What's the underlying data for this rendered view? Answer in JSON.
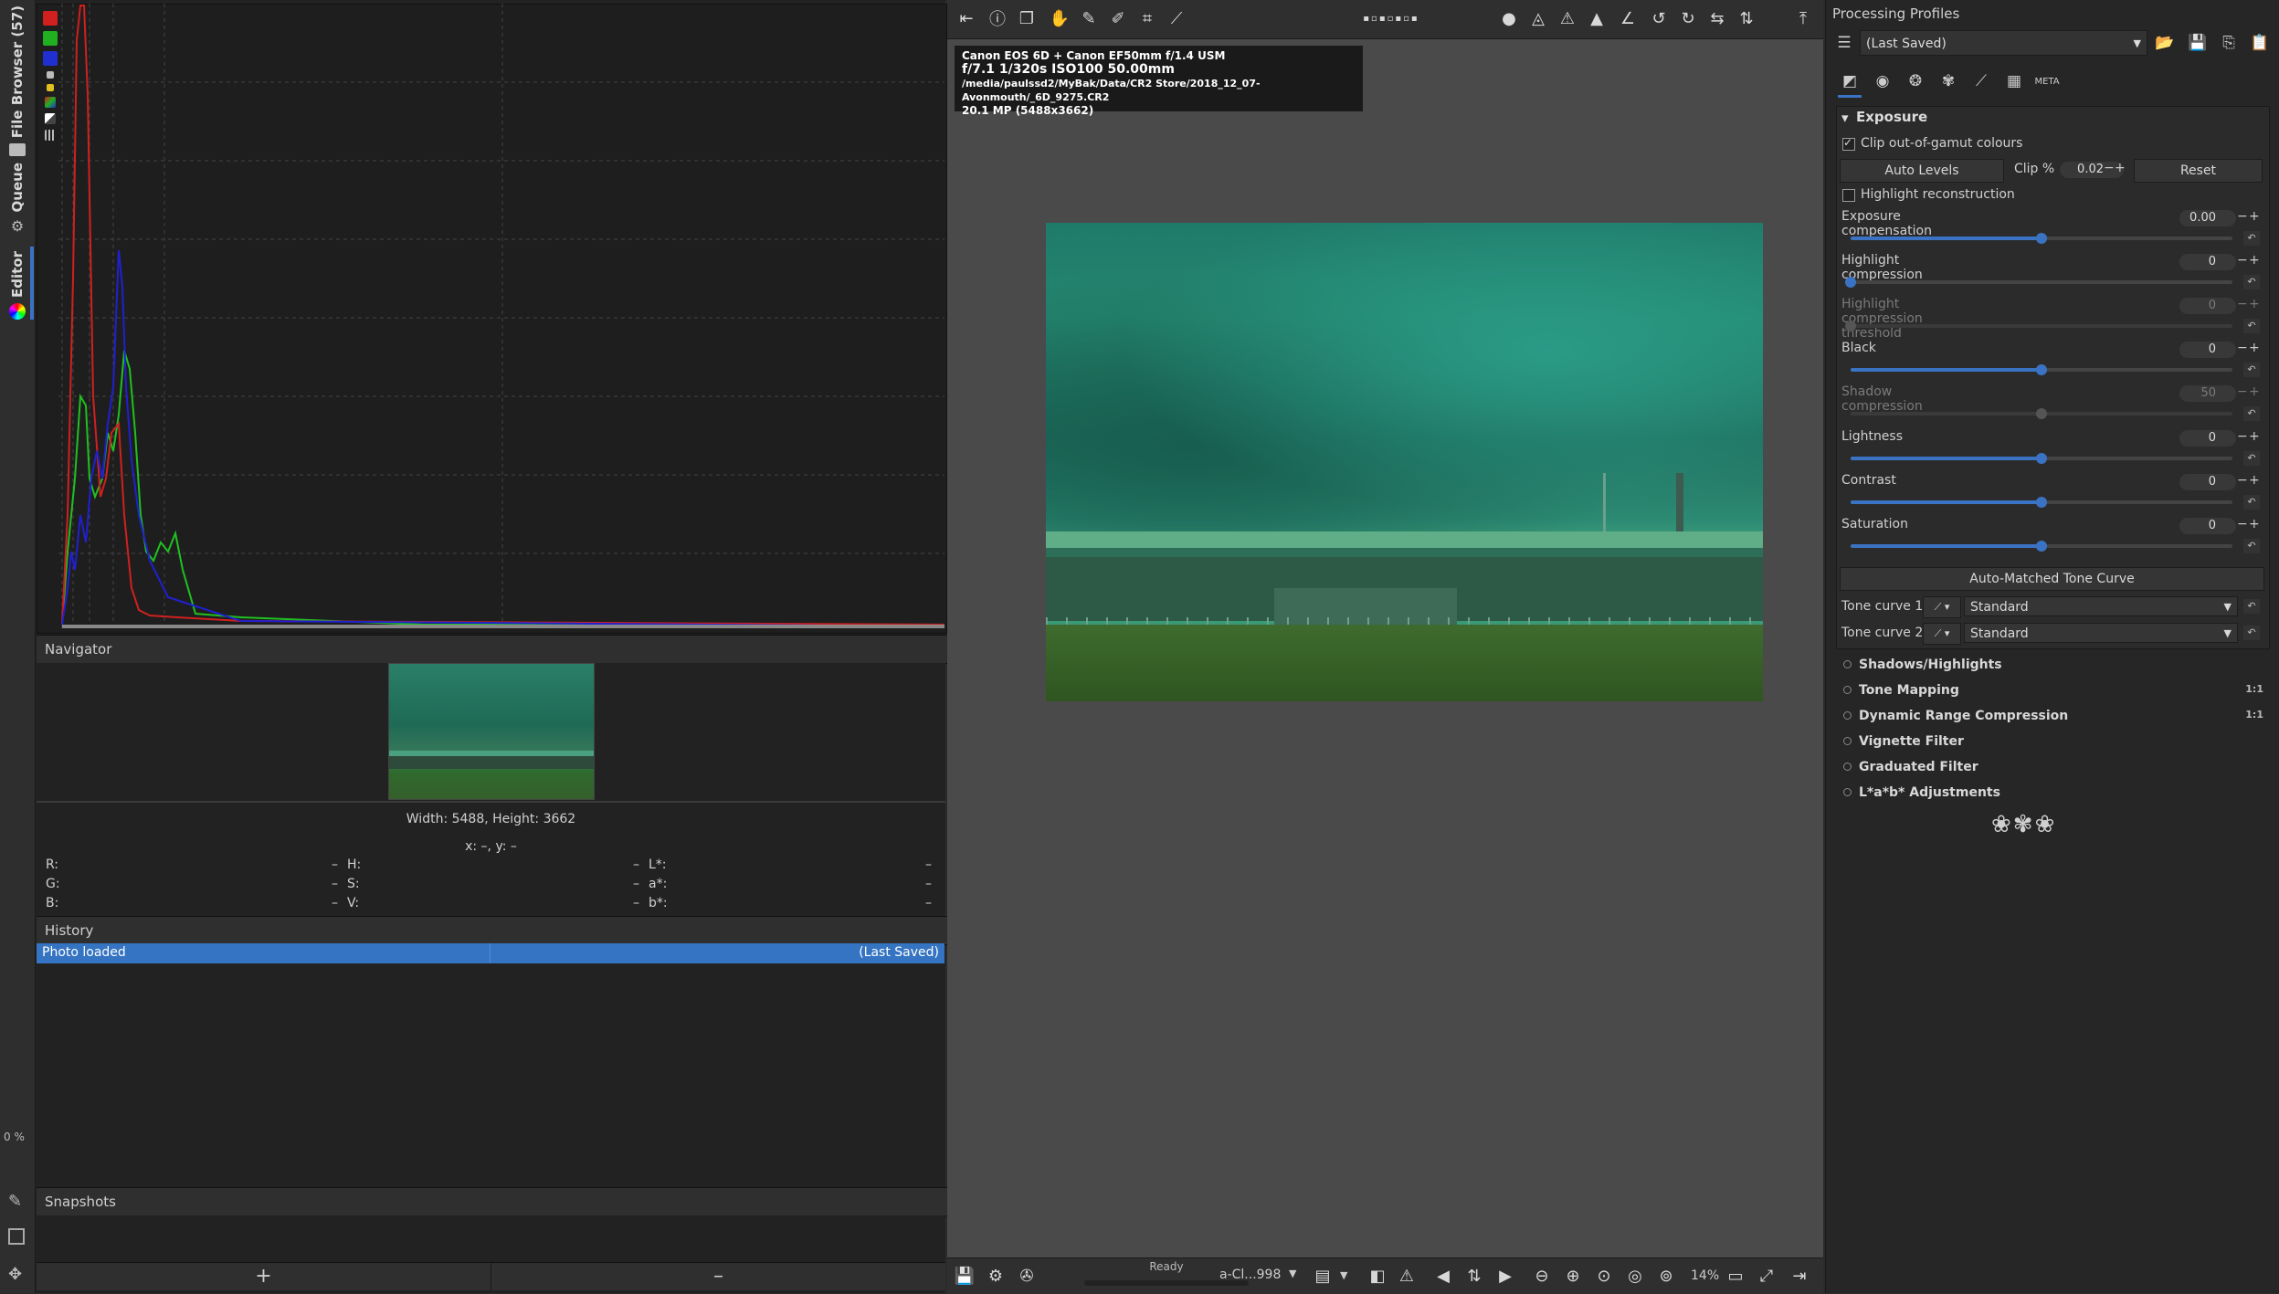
{
  "left_tabs": {
    "file_browser": "File Browser (57)",
    "queue": "Queue",
    "editor": "Editor",
    "progress": "0 %"
  },
  "navigator": {
    "title": "Navigator",
    "dimensions": "Width: 5488, Height: 3662",
    "coords": "x: –, y: –",
    "values": [
      {
        "label": "R:",
        "value": "–"
      },
      {
        "label": "H:",
        "value": "–"
      },
      {
        "label": "L*:",
        "value": "–"
      },
      {
        "label": "G:",
        "value": "–"
      },
      {
        "label": "S:",
        "value": "–"
      },
      {
        "label": "a*:",
        "value": "–"
      },
      {
        "label": "B:",
        "value": "–"
      },
      {
        "label": "V:",
        "value": "–"
      },
      {
        "label": "b*:",
        "value": "–"
      }
    ]
  },
  "history": {
    "title": "History",
    "rows": [
      {
        "action": "Photo loaded",
        "tag": "(Last Saved)"
      }
    ]
  },
  "snapshots": {
    "title": "Snapshots",
    "add_label": "+",
    "remove_label": "–"
  },
  "exif": {
    "camera": "Canon EOS 6D + Canon EF50mm f/1.4 USM",
    "exposure": "f/7.1  1/320s  ISO100  50.00mm",
    "path": "/media/paulssd2/MyBak/Data/CR2 Store/2018_12_07-Avonmouth/_6D_9275.CR2",
    "megapixels": "20.1 MP (5488x3662)"
  },
  "status": {
    "ready": "Ready",
    "profile_short": "a-Cl...998",
    "zoom": "14%"
  },
  "processing_profiles": {
    "title": "Processing Profiles",
    "selected": "(Last Saved)"
  },
  "exposure": {
    "title": "Exposure",
    "clip_gamut_label": "Clip out-of-gamut colours",
    "auto_levels_label": "Auto Levels",
    "clip_label": "Clip %",
    "clip_value": "0.02",
    "reset_label": "Reset",
    "highlight_recon_label": "Highlight reconstruction",
    "auto_tone_label": "Auto-Matched Tone Curve",
    "tone_curve1_label": "Tone curve 1:",
    "tone_curve1_value": "Standard",
    "tone_curve2_label": "Tone curve 2:",
    "tone_curve2_value": "Standard",
    "sliders": [
      {
        "label": "Exposure compensation",
        "value": "0.00",
        "level": 0.5,
        "dim": false
      },
      {
        "label": "Highlight compression",
        "value": "0",
        "level": 0.0,
        "dim": false
      },
      {
        "label": "Highlight compression threshold",
        "value": "0",
        "level": 0.0,
        "dim": true
      },
      {
        "label": "Black",
        "value": "0",
        "level": 0.5,
        "dim": false
      },
      {
        "label": "Shadow compression",
        "value": "50",
        "level": 0.5,
        "dim": true
      },
      {
        "label": "Lightness",
        "value": "0",
        "level": 0.5,
        "dim": false
      },
      {
        "label": "Contrast",
        "value": "0",
        "level": 0.5,
        "dim": false
      },
      {
        "label": "Saturation",
        "value": "0",
        "level": 0.5,
        "dim": false
      }
    ]
  },
  "collapsed_tools": [
    {
      "label": "Shadows/Highlights",
      "badge": ""
    },
    {
      "label": "Tone Mapping",
      "badge": "1:1"
    },
    {
      "label": "Dynamic Range Compression",
      "badge": "1:1"
    },
    {
      "label": "Vignette Filter",
      "badge": ""
    },
    {
      "label": "Graduated Filter",
      "badge": ""
    },
    {
      "label": "L*a*b* Adjustments",
      "badge": ""
    }
  ],
  "colors": {
    "accent": "#3b73c4",
    "hist_red": "#d02020",
    "hist_green": "#20c020",
    "hist_blue": "#2020d0"
  }
}
